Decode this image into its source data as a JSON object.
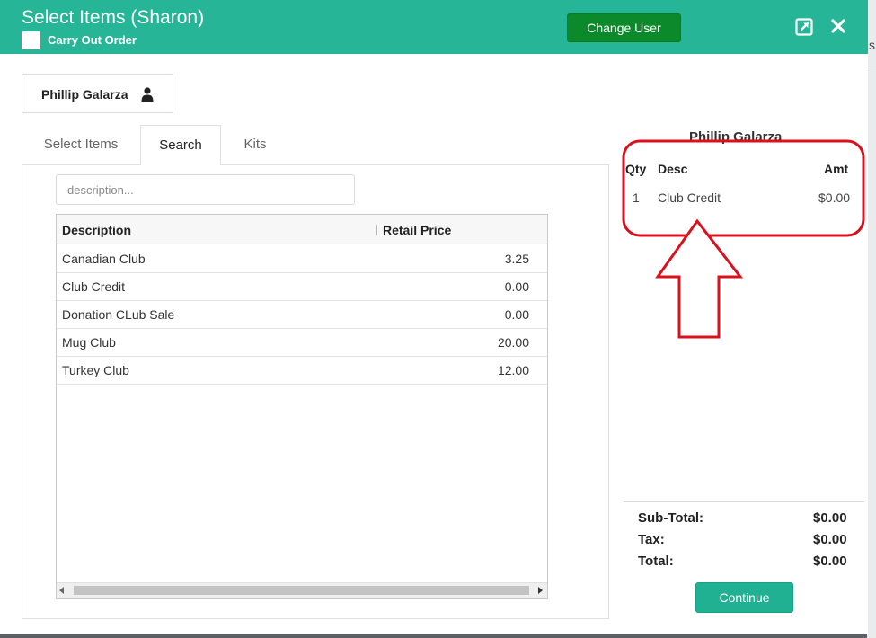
{
  "header": {
    "title": "Select Items (Sharon)",
    "carry_out_label": "Carry Out Order",
    "change_user_label": "Change User",
    "colors": {
      "header_bg": "#26b596",
      "change_user_bg": "#0c8a2b"
    }
  },
  "customer": {
    "name": "Phillip Galarza",
    "icon": "user-icon"
  },
  "tabs": [
    {
      "label": "Select Items",
      "active": false
    },
    {
      "label": "Search",
      "active": true
    },
    {
      "label": "Kits",
      "active": false
    }
  ],
  "search": {
    "value": "",
    "placeholder": "description..."
  },
  "grid": {
    "columns": [
      "Description",
      "Retail Price"
    ],
    "rows": [
      {
        "description": "Canadian Club",
        "price": "3.25"
      },
      {
        "description": "Club Credit",
        "price": "0.00"
      },
      {
        "description": "Donation CLub Sale",
        "price": "0.00"
      },
      {
        "description": "Mug Club",
        "price": "20.00"
      },
      {
        "description": "Turkey Club",
        "price": "12.00"
      }
    ]
  },
  "order": {
    "customer_name": "Phillip Galarza",
    "columns": {
      "qty": "Qty",
      "desc": "Desc",
      "amt": "Amt"
    },
    "lines": [
      {
        "qty": "1",
        "desc": "Club Credit",
        "amt": "$0.00"
      }
    ],
    "totals": {
      "subtotal_label": "Sub-Total:",
      "subtotal": "$0.00",
      "tax_label": "Tax:",
      "tax": "$0.00",
      "total_label": "Total:",
      "total": "$0.00"
    },
    "continue_label": "Continue"
  },
  "background": {
    "fragment": "s"
  },
  "annotation": {
    "color": "#d9111d"
  }
}
